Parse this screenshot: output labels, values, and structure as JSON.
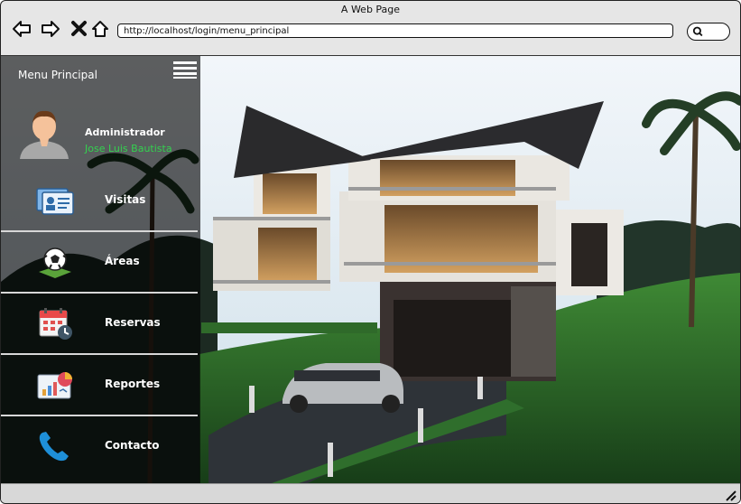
{
  "window": {
    "title": "A Web Page"
  },
  "toolbar": {
    "url": "http://localhost/login/menu_principal"
  },
  "sidebar": {
    "title": "Menu Principal",
    "user": {
      "role": "Administrador",
      "name": "Jose Luis Bautista"
    },
    "items": [
      {
        "label": "Visitas",
        "icon": "id-card-icon"
      },
      {
        "label": "Áreas",
        "icon": "soccer-ball-icon"
      },
      {
        "label": "Reservas",
        "icon": "calendar-clock-icon"
      },
      {
        "label": "Reportes",
        "icon": "report-chart-icon"
      },
      {
        "label": "Contacto",
        "icon": "phone-icon"
      }
    ]
  },
  "colors": {
    "username": "#33d24f",
    "sidebar_bg": "rgba(0,0,0,0.62)"
  }
}
